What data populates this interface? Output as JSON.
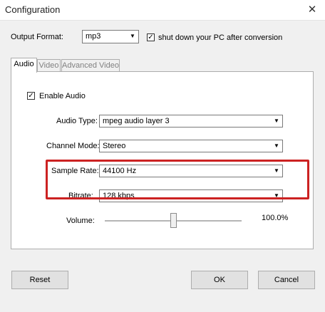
{
  "window": {
    "title": "Configuration",
    "close_glyph": "✕"
  },
  "output": {
    "label": "Output Format:",
    "value": "mp3",
    "shutdown_checked": true,
    "shutdown_label": "shut down your PC after conversion"
  },
  "tabs": [
    {
      "label": "Audio",
      "active": true
    },
    {
      "label": "Video",
      "active": false
    },
    {
      "label": "Advanced Video",
      "active": false
    }
  ],
  "audio": {
    "enable_checked": true,
    "enable_label": "Enable Audio",
    "audio_type": {
      "label": "Audio Type:",
      "value": "mpeg audio layer 3"
    },
    "channel_mode": {
      "label": "Channel Mode:",
      "value": "Stereo"
    },
    "sample_rate": {
      "label": "Sample Rate:",
      "value": "44100 Hz"
    },
    "bitrate": {
      "label": "Bitrate:",
      "value": "128 kbps"
    },
    "volume": {
      "label": "Volume:",
      "value_text": "100.0%",
      "level": 0.5
    }
  },
  "buttons": {
    "reset": "Reset",
    "ok": "OK",
    "cancel": "Cancel"
  },
  "icons": {
    "dropdown": "chevron-down-icon",
    "check": "check-icon"
  },
  "colors": {
    "highlight": "#cc2222"
  }
}
